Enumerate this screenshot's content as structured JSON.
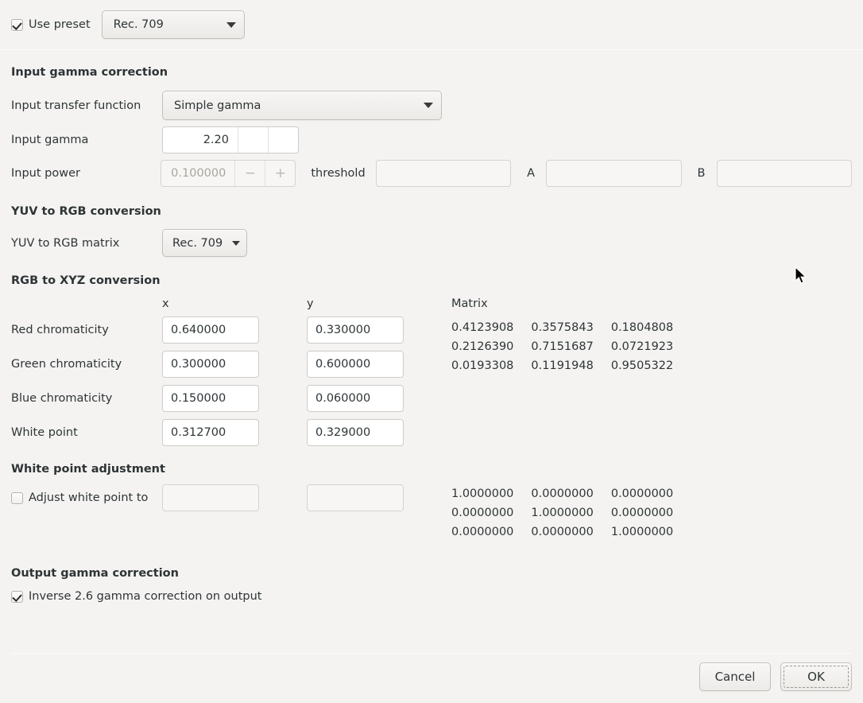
{
  "preset_bar": {
    "use_preset_label": "Use preset",
    "use_preset_checked": true,
    "preset_value": "Rec. 709"
  },
  "input_gamma": {
    "title": "Input gamma correction",
    "transfer_function_label": "Input transfer function",
    "transfer_function_value": "Simple gamma",
    "gamma_label": "Input gamma",
    "gamma_value": "2.20",
    "power_label": "Input power",
    "power_value": "0.100000",
    "spin_minus": "−",
    "spin_plus": "+",
    "threshold_label": "threshold",
    "threshold_value": "",
    "a_label": "A",
    "a_value": "",
    "b_label": "B",
    "b_value": ""
  },
  "yuv": {
    "title": "YUV to RGB conversion",
    "matrix_label": "YUV to RGB matrix",
    "matrix_value": "Rec. 709"
  },
  "rgb_xyz": {
    "title": "RGB to XYZ conversion",
    "col_x": "x",
    "col_y": "y",
    "matrix_caption": "Matrix",
    "rows": [
      {
        "label": "Red chromaticity",
        "x": "0.640000",
        "y": "0.330000"
      },
      {
        "label": "Green chromaticity",
        "x": "0.300000",
        "y": "0.600000"
      },
      {
        "label": "Blue chromaticity",
        "x": "0.150000",
        "y": "0.060000"
      },
      {
        "label": "White point",
        "x": "0.312700",
        "y": "0.329000"
      }
    ],
    "matrix": [
      [
        "0.4123908",
        "0.3575843",
        "0.1804808"
      ],
      [
        "0.2126390",
        "0.7151687",
        "0.0721923"
      ],
      [
        "0.0193308",
        "0.1191948",
        "0.9505322"
      ]
    ]
  },
  "white_point": {
    "title": "White point adjustment",
    "adjust_label": "Adjust white point to",
    "adjust_checked": false,
    "x_value": "",
    "y_value": "",
    "matrix": [
      [
        "1.0000000",
        "0.0000000",
        "0.0000000"
      ],
      [
        "0.0000000",
        "1.0000000",
        "0.0000000"
      ],
      [
        "0.0000000",
        "0.0000000",
        "1.0000000"
      ]
    ]
  },
  "output_gamma": {
    "title": "Output gamma correction",
    "inverse_label": "Inverse 2.6 gamma correction on output",
    "inverse_checked": true
  },
  "actions": {
    "cancel_label": "Cancel",
    "ok_label": "OK"
  },
  "colors": {
    "background": "#f4f3f1",
    "text": "#2e3436",
    "entry_background": "#ffffff",
    "border": "#cfccc7",
    "disabled_text": "#a9a5a0"
  }
}
